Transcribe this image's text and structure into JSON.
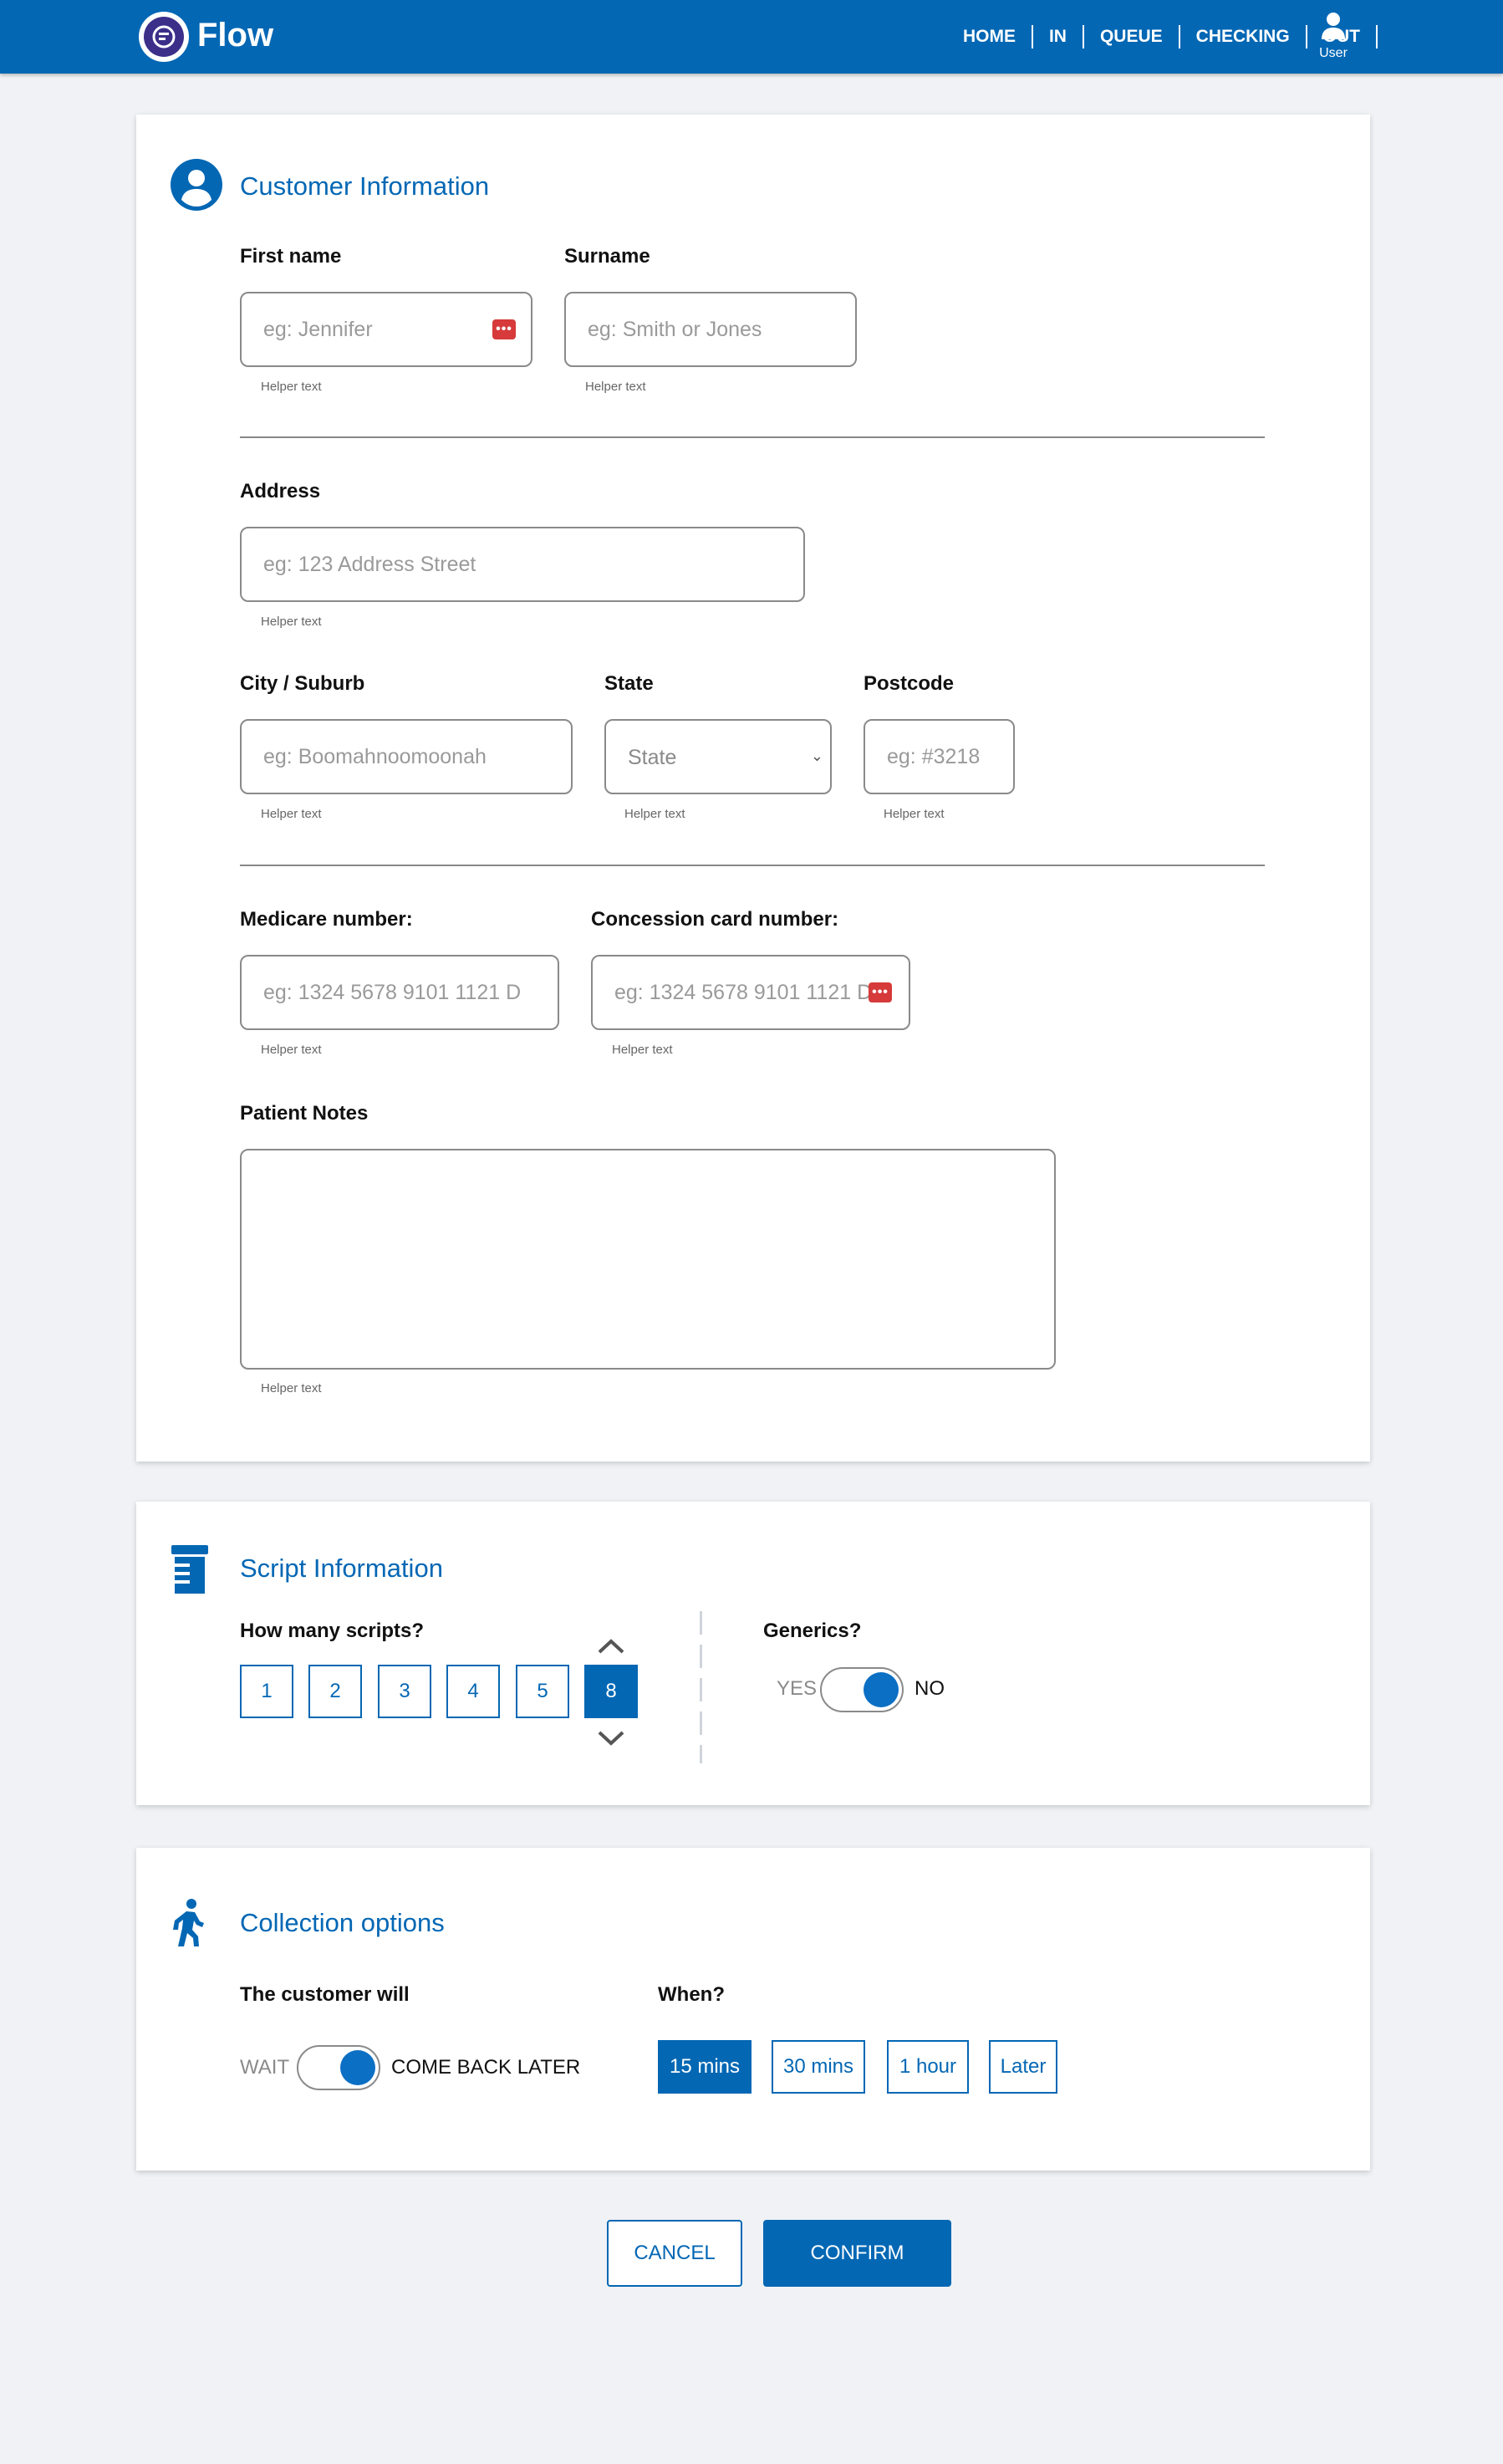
{
  "app": {
    "brand": "Flow"
  },
  "nav": {
    "items": [
      "HOME",
      "IN",
      "QUEUE",
      "CHECKING",
      "OUT"
    ],
    "user_label": "User"
  },
  "customer": {
    "title": "Customer Information",
    "first_name": {
      "label": "First name",
      "placeholder": "eg: Jennifer",
      "helper": "Helper text"
    },
    "surname": {
      "label": "Surname",
      "placeholder": "eg: Smith or Jones",
      "helper": "Helper text"
    },
    "address": {
      "label": "Address",
      "placeholder": "eg: 123 Address Street",
      "helper": "Helper text"
    },
    "city": {
      "label": "City / Suburb",
      "placeholder": "eg: Boomahnoomoonah",
      "helper": "Helper text"
    },
    "state": {
      "label": "State",
      "value": "State",
      "helper": "Helper text"
    },
    "postcode": {
      "label": "Postcode",
      "placeholder": "eg: #3218",
      "helper": "Helper text"
    },
    "medicare": {
      "label": "Medicare number:",
      "placeholder": "eg: 1324 5678 9101 1121 D",
      "helper": "Helper text"
    },
    "concession": {
      "label": "Concession card number:",
      "placeholder": "eg: 1324 5678 9101 1121 D",
      "helper": "Helper text"
    },
    "notes": {
      "label": "Patient Notes",
      "helper": "Helper text"
    },
    "badge_glyph": "•••"
  },
  "script": {
    "title": "Script Information",
    "how_many_label": "How many scripts?",
    "options": [
      "1",
      "2",
      "3",
      "4",
      "5",
      "8"
    ],
    "selected": "8",
    "generics_label": "Generics?",
    "yes_label": "YES",
    "no_label": "NO"
  },
  "collection": {
    "title": "Collection options",
    "customer_will_label": "The customer will",
    "wait_label": "WAIT",
    "come_back_label": "COME BACK LATER",
    "when_label": "When?",
    "times": [
      "15 mins",
      "30 mins",
      "1 hour",
      "Later"
    ],
    "selected_time": "15 mins"
  },
  "actions": {
    "cancel": "CANCEL",
    "confirm": "CONFIRM"
  },
  "colors": {
    "primary": "#0367b4",
    "background": "#f0f2f5",
    "error_badge": "#d63a3a"
  },
  "icons": {
    "logo": "flow-logo-icon",
    "user": "user-icon",
    "customer": "account-circle-icon",
    "script": "prescription-bottle-icon",
    "collection": "walking-person-icon"
  }
}
